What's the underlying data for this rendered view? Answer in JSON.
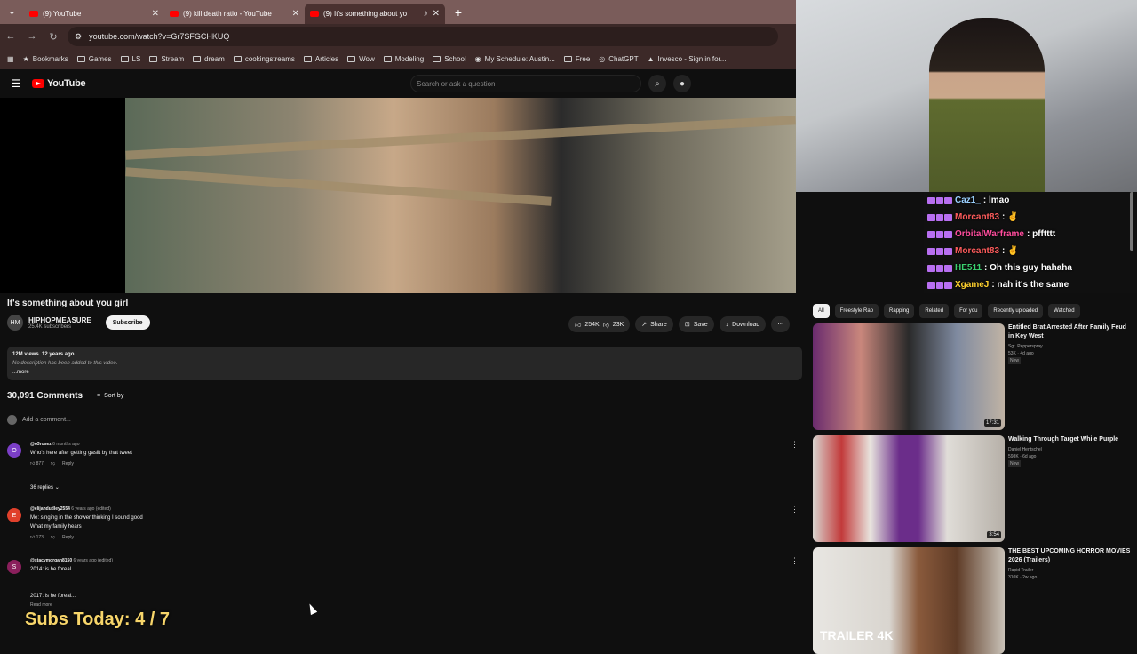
{
  "browser": {
    "tabs": [
      {
        "title": "(9) YouTube",
        "active": false
      },
      {
        "title": "(9) kill death ratio - YouTube",
        "active": false
      },
      {
        "title": "(9) It's something about yo",
        "active": true
      }
    ],
    "url": "youtube.com/watch?v=Gr7SFGCHKUQ",
    "bookmarks": [
      "Bookmarks",
      "Games",
      "LS",
      "Stream",
      "dream",
      "cookingstreams",
      "Articles",
      "Wow",
      "Modeling",
      "School",
      "My Schedule: Austin...",
      "Free",
      "ChatGPT",
      "Invesco - Sign in for..."
    ]
  },
  "youtube": {
    "logo": "YouTube",
    "search_placeholder": "Search or ask a question"
  },
  "video": {
    "title": "It's something about you girl",
    "channel": "HIPHOPMEASURE",
    "subscribers": "25.4K subscribers",
    "subscribe_label": "Subscribe",
    "likes": "254K",
    "dislikes": "23K",
    "share": "Share",
    "save": "Save",
    "download": "Download",
    "views": "12M views",
    "age": "12 years ago",
    "description": "No description has been added to this video.",
    "more": "...more"
  },
  "comments": {
    "count": "30,091 Comments",
    "sort": "Sort by",
    "add": "Add a comment...",
    "items": [
      {
        "initial": "O",
        "color": "#7b3ec7",
        "user": "@o3rosez",
        "when": "6 months ago",
        "text": "Who's here after getting gaslit by that tweet",
        "likes": "877",
        "reply": "Reply",
        "replies": "36 replies"
      },
      {
        "initial": "E",
        "color": "#e0402b",
        "user": "@elijahdudley2554",
        "when": "6 years ago (edited)",
        "text": "Me: singing in the shower thinking I sound good",
        "text2": "What my family hears",
        "likes": "173",
        "reply": "Reply"
      },
      {
        "initial": "S",
        "color": "#8a1f5c",
        "user": "@stacymorgan8150",
        "when": "6 years ago (edited)",
        "text": "2014: is he foreal",
        "text2": "2017: is he foreal...",
        "more": "Read more"
      }
    ]
  },
  "chips": [
    "All",
    "Freestyle Rap",
    "Rapping",
    "Related",
    "For you",
    "Recently uploaded",
    "Watched"
  ],
  "recommendations": [
    {
      "title": "Entitled Brat Arrested After Family Feud in Key West",
      "channel": "Sgt. Pepperspray",
      "stats": "53K · 4d ago",
      "badge": "New",
      "duration": "17:31"
    },
    {
      "title": "Walking Through Target While Purple",
      "channel": "Daniel Hentschel",
      "stats": "598K · 6d ago",
      "badge": "New",
      "duration": "3:54"
    },
    {
      "title": "THE BEST UPCOMING HORROR MOVIES 2026 (Trailers)",
      "channel": "Rapid Trailer",
      "stats": "310K · 2w ago",
      "thumb_text": "TRAILER 4K"
    }
  ],
  "chat": [
    {
      "user": "Caz1_",
      "msg": ": lmao",
      "color": "#9ad0ff"
    },
    {
      "user": "Morcant83",
      "msg": ": ✌",
      "color": "#ff4d4d"
    },
    {
      "user": "OrbitalWarframe",
      "msg": ": pfftttt",
      "color": "#ff4d9d"
    },
    {
      "user": "Morcant83",
      "msg": ": ✌",
      "color": "#ff4d4d"
    },
    {
      "user": "HE511",
      "msg": ": Oh this guy hahaha",
      "color": "#3bd16f"
    },
    {
      "user": "XgameJ",
      "msg": ": nah it's the same",
      "color": "#ffd12e"
    }
  ],
  "overlay": {
    "text": "Subs Today: 4 / 7"
  }
}
